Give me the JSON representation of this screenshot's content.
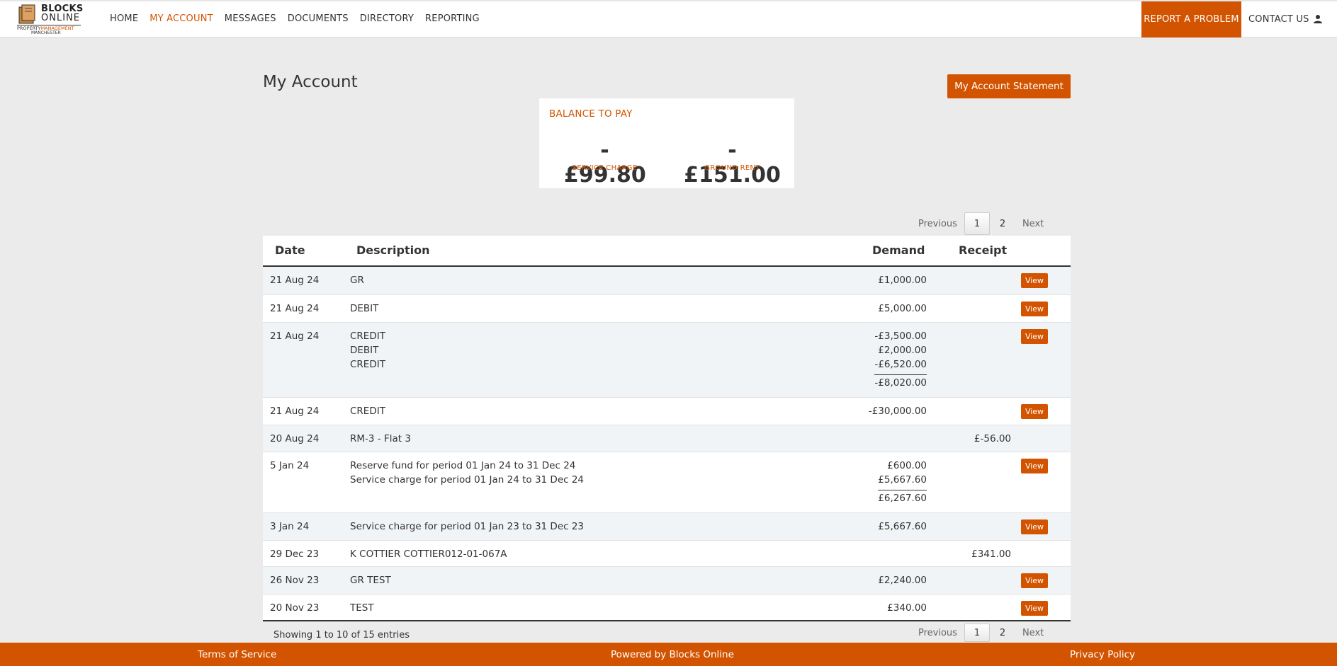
{
  "logo": {
    "line1": "BLOCKS",
    "line2": "ONLINE",
    "tag_a": "PROPERTY",
    "tag_b": "MANAGEMENT",
    "tag_c": "MANCHESTER"
  },
  "nav": {
    "items": [
      {
        "label": "HOME",
        "active": false
      },
      {
        "label": "MY ACCOUNT",
        "active": true
      },
      {
        "label": "MESSAGES",
        "active": false
      },
      {
        "label": "DOCUMENTS",
        "active": false
      },
      {
        "label": "DIRECTORY",
        "active": false
      },
      {
        "label": "REPORTING",
        "active": false
      }
    ],
    "report_label": "REPORT A PROBLEM",
    "contact_label": "CONTACT US",
    "user_icon": "user-icon"
  },
  "page": {
    "title": "My Account",
    "statement_label": "My Account Statement"
  },
  "balance": {
    "title": "BALANCE TO PAY",
    "service_charge": {
      "amount": "-£99.80",
      "label": "SERVICE CHARGE"
    },
    "ground_rent": {
      "amount": "-£151.00",
      "label": "GROUND RENT"
    }
  },
  "pagination": {
    "previous": "Previous",
    "pages": [
      "1",
      "2"
    ],
    "current": "1",
    "next": "Next"
  },
  "table": {
    "headers": {
      "date": "Date",
      "description": "Description",
      "demand": "Demand",
      "receipt": "Receipt"
    },
    "view_label": "View",
    "rows": [
      {
        "date": "21 Aug 24",
        "desc": [
          "GR"
        ],
        "demand": [
          "£1,000.00"
        ],
        "total": "",
        "receipt": "",
        "view": true,
        "height": 40
      },
      {
        "date": "21 Aug 24",
        "desc": [
          "DEBIT"
        ],
        "demand": [
          "£5,000.00"
        ],
        "total": "",
        "receipt": "",
        "view": true,
        "height": 39
      },
      {
        "date": "21 Aug 24",
        "desc": [
          "CREDIT",
          "DEBIT",
          "CREDIT"
        ],
        "demand": [
          "-£3,500.00",
          "£2,000.00",
          "-£6,520.00"
        ],
        "total": "-£8,020.00",
        "receipt": "",
        "view": true,
        "height": 106
      },
      {
        "date": "21 Aug 24",
        "desc": [
          "CREDIT"
        ],
        "demand": [
          "-£30,000.00"
        ],
        "total": "",
        "receipt": "",
        "view": true,
        "height": 39
      },
      {
        "date": "20 Aug 24",
        "desc": [
          "RM-3 - Flat 3"
        ],
        "demand": [],
        "total": "",
        "receipt": "£-56.00",
        "view": false,
        "height": 38
      },
      {
        "date": "5 Jan 24",
        "desc": [
          "Reserve fund for period 01 Jan 24 to 31 Dec 24",
          "Service charge for period 01 Jan 24 to 31 Dec 24"
        ],
        "demand": [
          "£600.00",
          "£5,667.60"
        ],
        "total": "£6,267.60",
        "receipt": "",
        "view": true,
        "height": 86
      },
      {
        "date": "3 Jan 24",
        "desc": [
          "Service charge for period 01 Jan 23 to 31 Dec 23"
        ],
        "demand": [
          "£5,667.60"
        ],
        "total": "",
        "receipt": "",
        "view": true,
        "height": 39
      },
      {
        "date": "29 Dec 23",
        "desc": [
          "K COTTIER COTTIER012-01-067A"
        ],
        "demand": [],
        "total": "",
        "receipt": "£341.00",
        "view": false,
        "height": 37
      },
      {
        "date": "26 Nov 23",
        "desc": [
          "GR TEST"
        ],
        "demand": [
          "£2,240.00"
        ],
        "total": "",
        "receipt": "",
        "view": true,
        "height": 39
      },
      {
        "date": "20 Nov 23",
        "desc": [
          "TEST"
        ],
        "demand": [
          "£340.00"
        ],
        "total": "",
        "receipt": "",
        "view": true,
        "height": 39
      }
    ],
    "showing": "Showing 1 to 10 of 15 entries"
  },
  "footer": {
    "terms": "Terms of Service",
    "powered": "Powered by Blocks Online",
    "privacy": "Privacy Policy"
  },
  "colors": {
    "accent": "#d35400",
    "background": "#ebebeb",
    "row_alt": "#f1f4f6"
  }
}
